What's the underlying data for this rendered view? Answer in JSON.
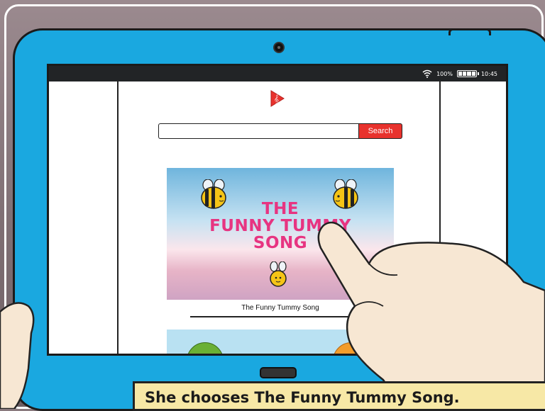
{
  "statusbar": {
    "battery_text": "100%",
    "time": "10:45"
  },
  "search": {
    "placeholder": "",
    "button_label": "Search"
  },
  "featured_video": {
    "title_line1": "THE",
    "title_line2": "FUNNY TUMMY",
    "title_line3": "SONG",
    "caption": "The Funny Tummy Song"
  },
  "story": {
    "caption": "She chooses The Funny Tummy Song."
  },
  "colors": {
    "tablet_frame": "#1aa8e0",
    "search_button": "#e8322d",
    "title_pink": "#e73481",
    "banner": "#f7e8a6"
  },
  "icons": {
    "logo": "music-play-logo-icon",
    "wifi": "wifi-icon",
    "battery": "battery-icon",
    "camera": "camera-icon"
  }
}
